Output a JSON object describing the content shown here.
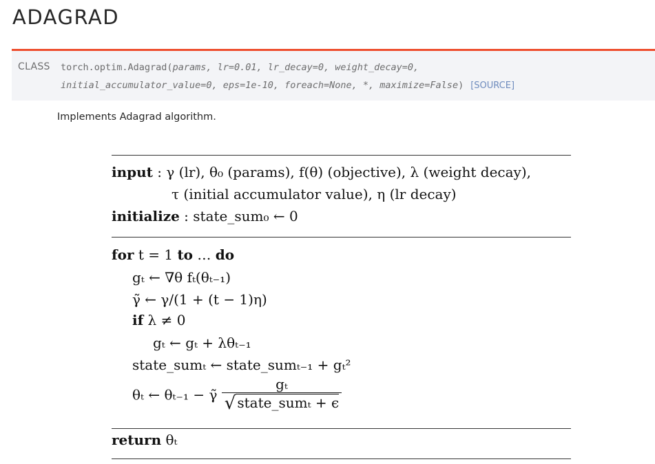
{
  "title": "ADAGRAD",
  "signature": {
    "label": "CLASS",
    "line1_prefix": "torch.optim.Adagrad(",
    "line1_params": "params, lr=0.01, lr_decay=0, weight_decay=0,",
    "line2_params": "initial_accumulator_value=0, eps=1e-10, foreach=None, *, maximize=False",
    "line2_close": ")",
    "source_link": "[SOURCE]"
  },
  "description": "Implements Adagrad algorithm.",
  "algorithm": {
    "input_keyword": "input",
    "input_line1": " : γ (lr), θ₀ (params), f(θ) (objective), λ (weight decay),",
    "input_line2": "τ (initial accumulator value), η (lr decay)",
    "initialize_keyword": "initialize",
    "initialize_rest": " : state_sum₀ ← 0",
    "for_keyword": "for",
    "for_mid": " t = 1 ",
    "to_keyword": "to",
    "for_dots": " … ",
    "do_keyword": "do",
    "step1": "gₜ ← ∇θ fₜ(θₜ₋₁)",
    "step2": "γ̃ ← γ/(1 + (t − 1)η)",
    "if_keyword": "if",
    "if_cond": " λ ≠ 0",
    "step3": "gₜ ← gₜ + λθₜ₋₁",
    "step4": "state_sumₜ ← state_sumₜ₋₁ + gₜ²",
    "step5_lhs": "θₜ ← θₜ₋₁ − γ̃",
    "step5_num": "gₜ",
    "step5_den": "state_sumₜ + ϵ",
    "return_keyword": "return",
    "return_val": " θₜ"
  }
}
